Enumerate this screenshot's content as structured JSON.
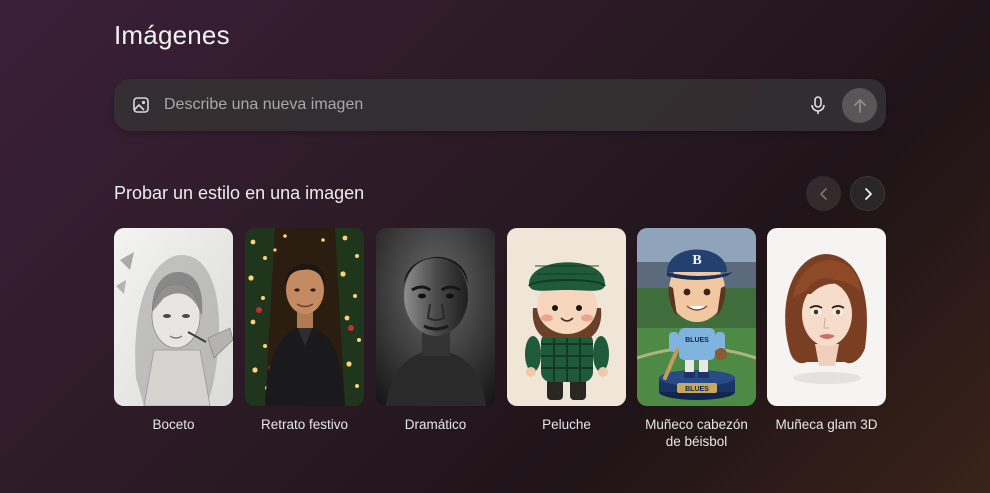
{
  "page": {
    "title": "Imágenes"
  },
  "prompt": {
    "placeholder": "Describe una nueva imagen"
  },
  "styles_section": {
    "title": "Probar un estilo en una imagen",
    "cards": [
      {
        "label": "Boceto",
        "image": "pencil-sketch-woman"
      },
      {
        "label": "Retrato festivo",
        "image": "festive-portrait-man-lights"
      },
      {
        "label": "Dramático",
        "image": "dramatic-bw-portrait"
      },
      {
        "label": "Peluche",
        "image": "plush-doll"
      },
      {
        "label": "Muñeco cabezón de béisbol",
        "image": "baseball-bobblehead"
      },
      {
        "label": "Muñeca glam 3D",
        "image": "3d-glam-doll"
      }
    ],
    "bobblehead_text": {
      "cap": "B",
      "jersey": "BLUES",
      "base": "BLUES"
    }
  },
  "icons": {
    "prompt_image": "image-icon",
    "mic": "microphone-icon",
    "send": "arrow-up-icon",
    "prev": "chevron-left-icon",
    "next": "chevron-right-icon"
  },
  "colors": {
    "background_start": "#3b2039",
    "background_end": "#3a2319",
    "prompt_bg": "#343032",
    "text": "#ececec"
  }
}
